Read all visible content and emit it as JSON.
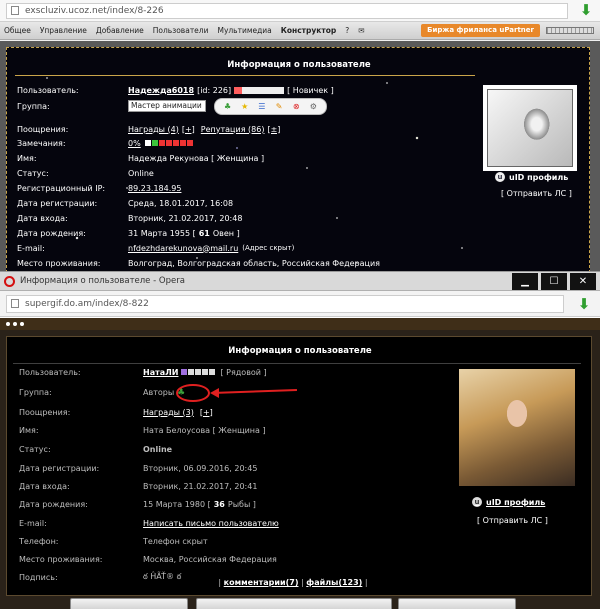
{
  "top_window": {
    "url": "exscluziv.ucoz.net/index/8-226",
    "ucoz_menu": [
      "Общее",
      "Управление",
      "Добавление",
      "Пользователи",
      "Мультимедиа",
      "Конструктор",
      "?"
    ],
    "upartner_label": "Биржа фриланса uPartner",
    "panel": {
      "header": "Информация о пользователе",
      "user_label": "Пользователь:",
      "user_name": "Надежда6018",
      "user_id": "[id: 226]",
      "user_rank": "[ Новичек ]",
      "group_label": "Группа:",
      "group_value": "Мастер анимации",
      "rewards_label": "Поощрения:",
      "rewards_link": "Награды (4)",
      "rewards_plus": "[+]",
      "reputation_link": "Репутация (86)",
      "reputation_plus": "[±]",
      "warnings_label": "Замечания:",
      "warnings_value": "0%",
      "name_label": "Имя:",
      "name_value": "Надежда Рекунова [ Женщина ]",
      "status_label": "Статус:",
      "status_value": "Online",
      "ip_label": "Регистрационный IP:",
      "ip_value": "89.23.184.95",
      "reg_label": "Дата регистрации:",
      "reg_value": "Среда, 18.01.2017, 16:08",
      "login_label": "Дата входа:",
      "login_value": "Вторник, 21.02.2017, 20:48",
      "birth_label": "Дата рождения:",
      "birth_value_pre": "31 Марта 1955 [",
      "birth_value_age": "61",
      "birth_value_post": "Овен ]",
      "email_label": "E-mail:",
      "email_value": "nfdezhdarekunova@mail.ru",
      "email_hidden": "(Адрес скрыт)",
      "residence_label": "Место проживания:",
      "residence_value": "Волгоград, Волгоградская область, Российская Федерация",
      "uid_profile": "uID профиль",
      "send_pm": "[ Отправить ЛС ]"
    }
  },
  "opera_window": {
    "title": "Информация о пользователе - Opera",
    "url": "supergif.do.am/index/8-822",
    "panel": {
      "header": "Информация о пользователе",
      "user_label": "Пользователь:",
      "user_name": "НатаЛИ",
      "user_rank": "[ Рядовой ]",
      "group_label": "Группа:",
      "group_value": "Авторы",
      "rewards_label": "Поощрения:",
      "rewards_link": "Награды (3)",
      "rewards_plus": "[+]",
      "name_label": "Имя:",
      "name_value": "Ната Белоусова [ Женщина ]",
      "status_label": "Статус:",
      "status_value": "Online",
      "reg_label": "Дата регистрации:",
      "reg_value": "Вторник, 06.09.2016, 20:45",
      "login_label": "Дата входа:",
      "login_value": "Вторник, 21.02.2017, 20:41",
      "birth_label": "Дата рождения:",
      "birth_value_pre": "15 Марта 1980 [",
      "birth_value_age": "36",
      "birth_value_post": "Рыбы ]",
      "email_label": "E-mail:",
      "email_value": "Написать письмо пользователю",
      "phone_label": "Телефон:",
      "phone_value": "Телефон скрыт",
      "residence_label": "Место проживания:",
      "residence_value": "Москва, Российская Федерация",
      "signature_label": "Подпись:",
      "signature_value": "ఠ ĤÃŤ® ఠ",
      "uid_profile": "uID профиль",
      "send_pm": "[ Отправить ЛС ]",
      "comments_link": "комментарии(7)",
      "files_link": "файлы(123)",
      "comments_sep_left": "|",
      "comments_sep_mid": "|",
      "comments_sep_right": "|"
    }
  },
  "colors": {
    "online_yellow": "#ffe24a",
    "gold_border": "#caa54a",
    "red_annotation": "#e02020",
    "upartner_orange": "#e8882a"
  }
}
